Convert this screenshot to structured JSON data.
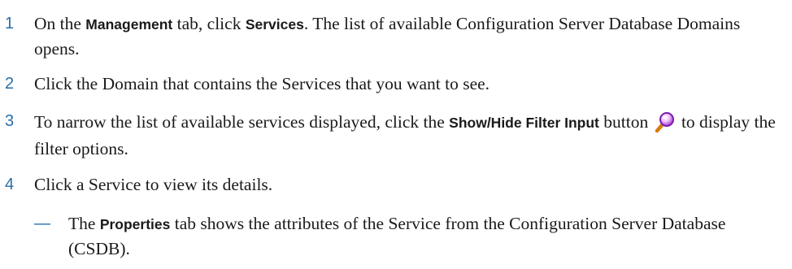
{
  "steps": [
    {
      "number": "1",
      "pre": "On the ",
      "ui1": "Management",
      "mid": " tab, click ",
      "ui2": "Services",
      "post": ". The list of available Configuration Server Database Domains opens."
    },
    {
      "number": "2",
      "text": "Click the Domain that contains the Services that you want to see."
    },
    {
      "number": "3",
      "pre": "To narrow the list of available services displayed, click the ",
      "ui1": "Show/Hide Filter Input",
      "mid": " button ",
      "post": " to display the filter options.",
      "icon": "magnifier-icon"
    },
    {
      "number": "4",
      "text": "Click a Service to view its details."
    }
  ],
  "substeps": [
    {
      "dash": "—",
      "pre": "The ",
      "ui": "Properties",
      "post": " tab shows the attributes of the Service from the Configuration Server Database (CSDB)."
    }
  ]
}
